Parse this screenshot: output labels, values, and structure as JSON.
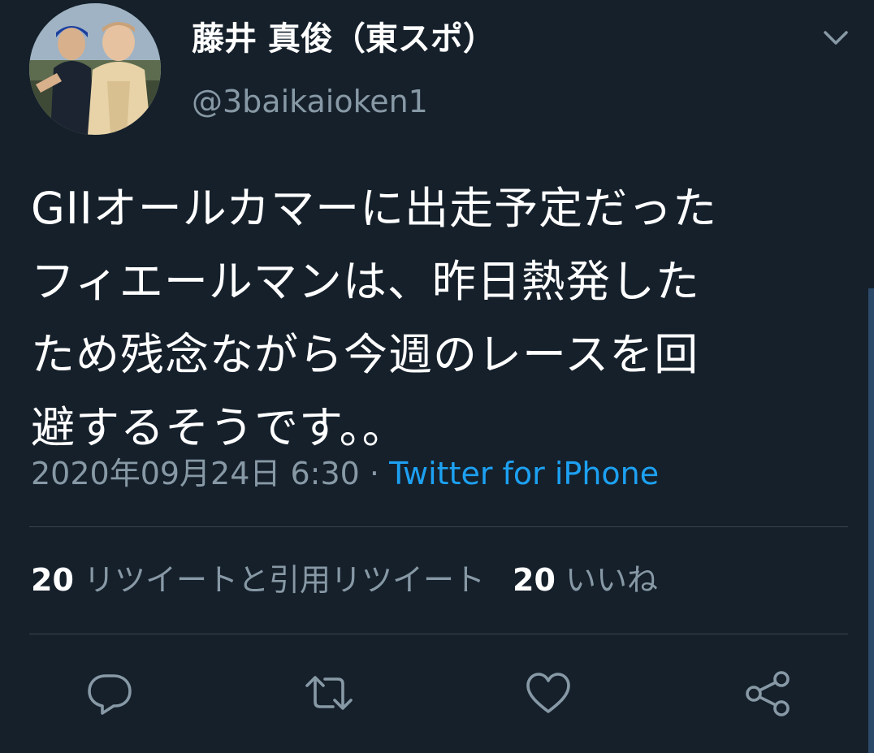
{
  "author": {
    "name": "藤井 真俊（東スポ）",
    "handle": "@3baikaioken1",
    "avatar_icon": "profile-photo"
  },
  "menu_icon": "chevron-down-icon",
  "tweet": {
    "lines": [
      "GIIオールカマーに出走予定だった",
      "フィエールマンは、昨日熱発した",
      "ため残念ながら今週のレースを回",
      "避するそうです。。"
    ],
    "timestamp": "2020年09月24日 6:30",
    "separator": "·",
    "source": "Twitter for iPhone"
  },
  "stats": {
    "retweet_count": "20",
    "retweet_label": "リツイートと引用リツイート",
    "like_count": "20",
    "like_label": "いいね"
  },
  "actions": {
    "reply_icon": "reply-icon",
    "retweet_icon": "retweet-icon",
    "like_icon": "heart-icon",
    "share_icon": "share-icon"
  },
  "colors": {
    "background": "#15202b",
    "text": "#ffffff",
    "secondary": "#8899a6",
    "link": "#1da1f2",
    "divider": "#38444d"
  }
}
